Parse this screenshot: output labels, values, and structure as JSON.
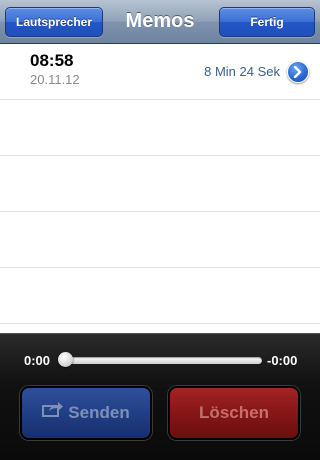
{
  "navbar": {
    "title": "Memos",
    "left_button": "Lautsprecher",
    "right_button": "Fertig"
  },
  "memos": [
    {
      "time": "08:58",
      "date": "20.11.12",
      "duration": "8 Min 24 Sek"
    }
  ],
  "player": {
    "elapsed": "0:00",
    "remaining": "-0:00",
    "progress": 0,
    "send_label": "Senden",
    "delete_label": "Löschen"
  },
  "icons": {
    "disclosure": "chevron-right-icon",
    "send": "share-arrow-icon"
  },
  "colors": {
    "nav_button": "#2a5fcf",
    "duration_text": "#3d5f92",
    "send_button": "#203f86",
    "delete_button": "#861616"
  }
}
